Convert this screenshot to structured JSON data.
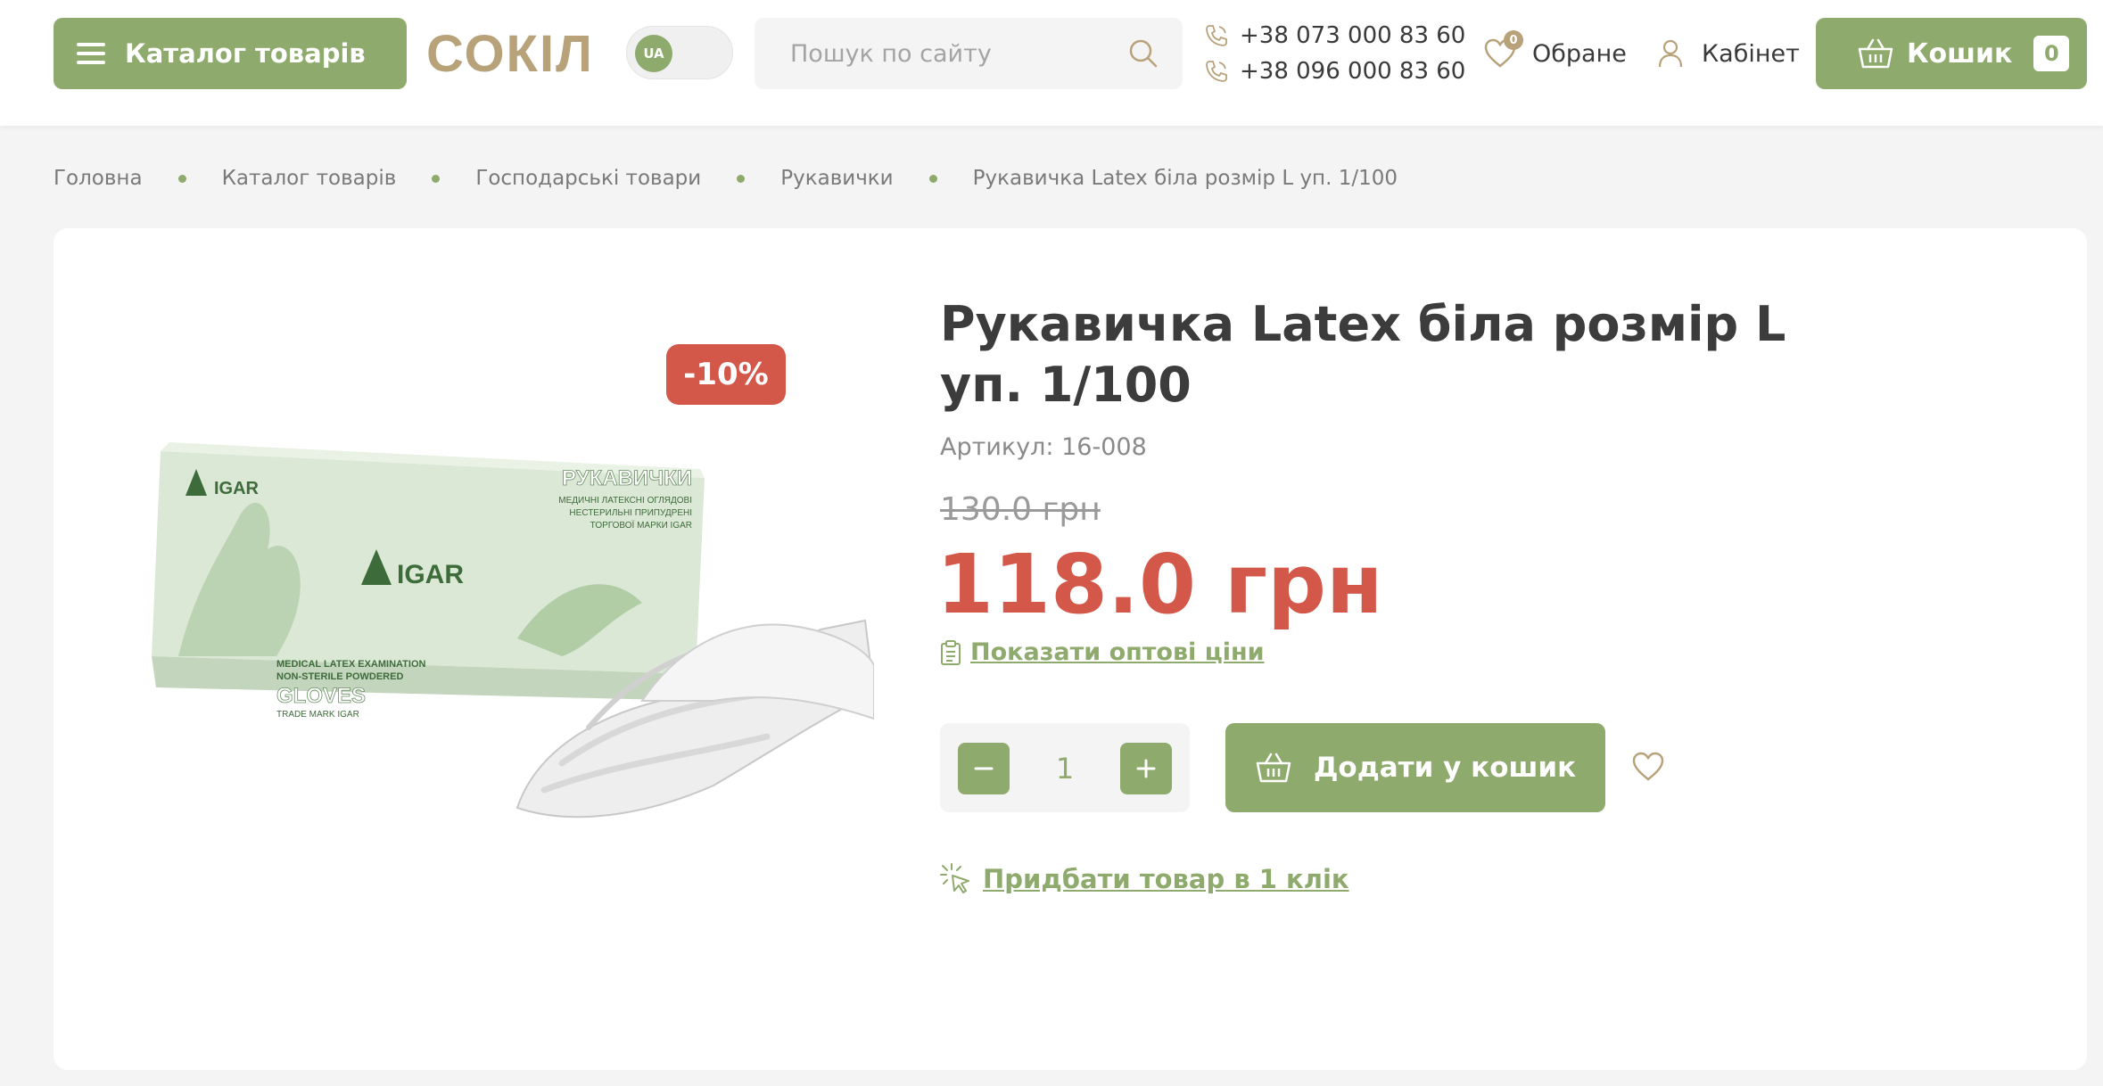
{
  "header": {
    "catalog_label": "Каталог товарів",
    "logo_text": "СОКІЛ",
    "language": "UA",
    "search_placeholder": "Пошук по сайту",
    "phones": [
      "+38 073 000 83 60",
      "+38 096 000 83 60"
    ],
    "favorites_label": "Обране",
    "favorites_count": "0",
    "cabinet_label": "Кабінет",
    "cart_label": "Кошик",
    "cart_count": "0"
  },
  "breadcrumb": [
    "Головна",
    "Каталог товарів",
    "Господарські товари",
    "Рукавички",
    "Рукавичка Latex біла розмір L уп. 1/100"
  ],
  "product": {
    "title": "Рукавичка Latex біла розмір L уп. 1/100",
    "sku": "Артикул: 16-008",
    "old_price": "130.0 грн",
    "price": "118.0 грн",
    "discount": "-10%",
    "wholesale_link": "Показати оптові ціни",
    "quantity": "1",
    "add_to_cart_label": "Додати у кошик",
    "one_click_label": "Придбати товар в 1 клік",
    "image": {
      "brand": "IGAR",
      "box_title": "РУКАВИЧКИ",
      "box_lines": [
        "МЕДИЧНІ ЛАТЕКСНІ ОГЛЯДОВІ",
        "НЕСТЕРИЛЬНІ ПРИПУДРЕНІ",
        "ТОРГОВОЇ МАРКИ IGAR"
      ],
      "box_en_lines": [
        "MEDICAL LATEX EXAMINATION",
        "NON-STERILE POWDERED"
      ],
      "box_gloves": "GLOVES",
      "box_trademark": "TRADE MARK IGAR"
    }
  },
  "colors": {
    "accent": "#8eaa6c",
    "price_red": "#d4584a",
    "logo_gold": "#b8a27a",
    "background": "#f4f4f4"
  },
  "icons": [
    "menu-icon",
    "search-icon",
    "phone-icon",
    "heart-icon",
    "user-icon",
    "basket-icon",
    "clipboard-icon",
    "minus-icon",
    "plus-icon",
    "click-icon"
  ]
}
